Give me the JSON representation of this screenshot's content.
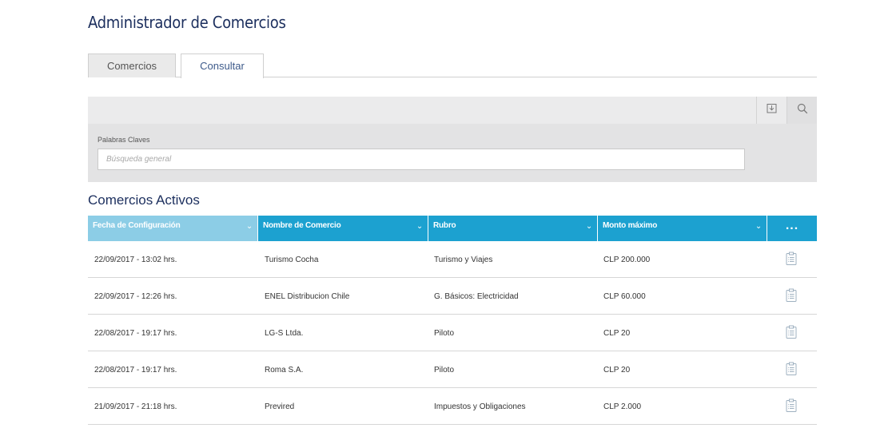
{
  "page": {
    "title": "Administrador de Comercios"
  },
  "tabs": [
    {
      "label": "Comercios"
    },
    {
      "label": "Consultar"
    }
  ],
  "search": {
    "label": "Palabras Claves",
    "placeholder": "Búsqueda general",
    "value": ""
  },
  "toolbar": {
    "download_icon": "download-icon",
    "search_icon": "search-icon"
  },
  "section": {
    "title": "Comercios Activos"
  },
  "table": {
    "columns": [
      "Fecha de Configuración",
      "Nombre de Comercio",
      "Rubro",
      "Monto máximo",
      "..."
    ],
    "rows": [
      {
        "fecha": "22/09/2017 - 13:02 hrs.",
        "nombre": "Turismo Cocha",
        "rubro": "Turismo y Viajes",
        "monto": "CLP 200.000"
      },
      {
        "fecha": "22/09/2017 - 12:26 hrs.",
        "nombre": "ENEL Distribucion Chile",
        "rubro": "G. Básicos: Electricidad",
        "monto": "CLP 60.000"
      },
      {
        "fecha": "22/08/2017 - 19:17 hrs.",
        "nombre": "LG-S Ltda.",
        "rubro": "Piloto",
        "monto": "CLP 20"
      },
      {
        "fecha": "22/08/2017 - 19:17 hrs.",
        "nombre": "Roma S.A.",
        "rubro": "Piloto",
        "monto": "CLP 20"
      },
      {
        "fecha": "21/09/2017 - 21:18 hrs.",
        "nombre": "Previred",
        "rubro": "Impuestos y Obligaciones",
        "monto": "CLP 2.000"
      }
    ]
  },
  "colors": {
    "header_active": "#8ccde6",
    "header": "#1ca1d0",
    "title": "#1c2f5e"
  }
}
